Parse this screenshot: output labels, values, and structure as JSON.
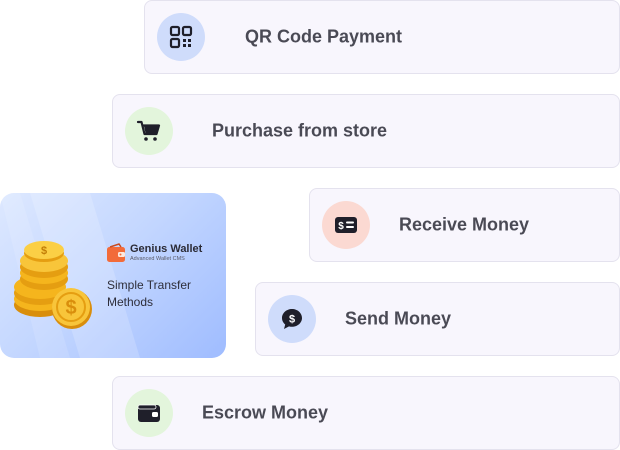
{
  "services": [
    {
      "label": "QR Code Payment",
      "icon": "qr-code-icon",
      "circle_color": "#cfdcfb"
    },
    {
      "label": "Purchase from store",
      "icon": "shopping-cart-icon",
      "circle_color": "#e3f5dc"
    },
    {
      "label": "Receive Money",
      "icon": "money-bill-icon",
      "circle_color": "#fbd9d2"
    },
    {
      "label": "Send Money",
      "icon": "dollar-chat-icon",
      "circle_color": "#cfdcfb"
    },
    {
      "label": "Escrow Money",
      "icon": "wallet-icon",
      "circle_color": "#e3f5dc"
    }
  ],
  "promo": {
    "brand_name": "Genius Wallet",
    "brand_tagline": "Advanced Wallet CMS",
    "text": "Simple Transfer Methods",
    "image": "gold-coins-icon",
    "logo": "wallet-logo-icon"
  },
  "colors": {
    "card_bg": "#f8f6fd",
    "label": "#4a4a55",
    "icon_dark": "#1f1f2a",
    "logo_orange": "#f26b3a",
    "coin_gold": "#f5b51d"
  }
}
